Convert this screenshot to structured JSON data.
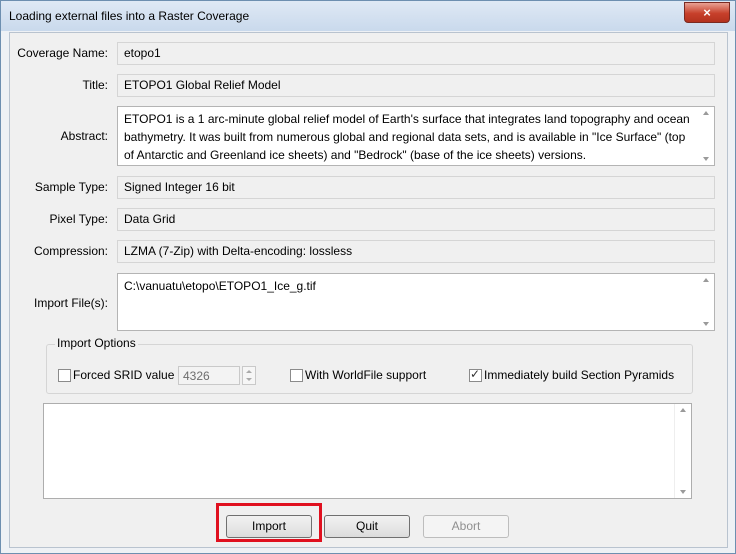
{
  "window": {
    "title": "Loading external files into a Raster Coverage",
    "close_icon": "×"
  },
  "form": {
    "coverage_name": {
      "label": "Coverage Name:",
      "value": "etopo1"
    },
    "title": {
      "label": "Title:",
      "value": "ETOPO1 Global Relief Model"
    },
    "abstract": {
      "label": "Abstract:",
      "value": "ETOPO1 is a 1 arc-minute global relief model of Earth's surface that integrates land topography and ocean bathymetry. It was built from numerous global and regional data sets, and is available in \"Ice Surface\" (top of Antarctic and Greenland ice sheets) and \"Bedrock\" (base of the ice sheets) versions."
    },
    "sample_type": {
      "label": "Sample Type:",
      "value": "Signed Integer 16 bit"
    },
    "pixel_type": {
      "label": "Pixel Type:",
      "value": "Data Grid"
    },
    "compression": {
      "label": "Compression:",
      "value": "LZMA (7-Zip) with Delta-encoding: lossless"
    },
    "import_files": {
      "label": "Import File(s):",
      "value": "C:\\vanuatu\\etopo\\ETOPO1_Ice_g.tif"
    }
  },
  "import_options": {
    "title": "Import Options",
    "forced_srid": {
      "label": "Forced SRID value",
      "checked": false,
      "value": "4326"
    },
    "worldfile": {
      "label": "With WorldFile support",
      "checked": false
    },
    "pyramids": {
      "label": "Immediately build Section Pyramids",
      "checked": true
    }
  },
  "buttons": {
    "import": "Import",
    "quit": "Quit",
    "abort": "Abort"
  },
  "colors": {
    "highlight": "#e0101f",
    "close": "#c7402b"
  }
}
